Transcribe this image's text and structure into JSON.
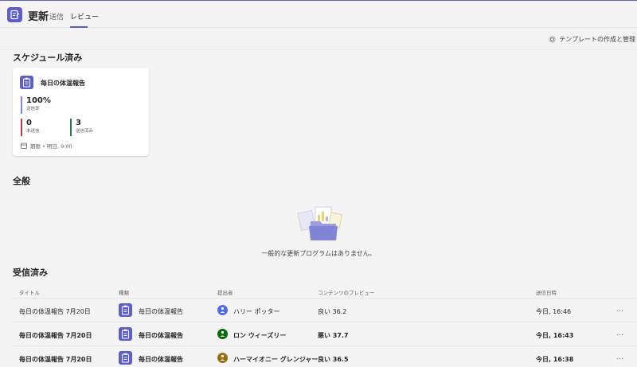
{
  "header": {
    "title": "更新",
    "tabs": [
      {
        "label": "送信"
      },
      {
        "label": "レビュー"
      }
    ]
  },
  "toolbar": {
    "template_link": "テンプレートの作成と管理"
  },
  "scheduled": {
    "title": "スケジュール済み",
    "card": {
      "title": "毎日の体温報告",
      "rate_value": "100%",
      "rate_label": "送信率",
      "unsent_value": "0",
      "unsent_label": "未送信",
      "sent_value": "3",
      "sent_label": "送信済み",
      "due": "期限 • 明日, 9:00"
    }
  },
  "general": {
    "title": "全般",
    "empty_text": "一般的な更新プログラムはありません。"
  },
  "received": {
    "title": "受信済み",
    "columns": [
      "タイトル",
      "種類",
      "提出者",
      "コンテンツのプレビュー",
      "送信日時"
    ],
    "rows": [
      {
        "title": "毎日の体温報告 7月20日",
        "type": "毎日の体温報告",
        "submitter": "ハリー ポッター",
        "preview": "良い 36.2",
        "sent": "今日, 16:46",
        "more": "...",
        "avatar_color": "#4f6bed"
      },
      {
        "title": "毎日の体温報告 7月20日",
        "type": "毎日の体温報告",
        "submitter": "ロン ウィーズリー",
        "preview": "悪い 37.7",
        "sent": "今日, 16:43",
        "more": "...",
        "avatar_color": "#0b6a0b"
      },
      {
        "title": "毎日の体温報告 7月20日",
        "type": "毎日の体温報告",
        "submitter": "ハーマイオニー グレンジャー",
        "preview": "良い 36.5",
        "sent": "今日, 16:38",
        "more": "...",
        "avatar_color": "#986f0b"
      }
    ]
  },
  "colors": {
    "brand": "#5b5fc7",
    "rate_bar": "#7f85f5",
    "unsent_bar": "#c4314b",
    "sent_bar": "#237b4b"
  },
  "icons": {
    "app": "clipboard-edit-icon",
    "template": "gear-icon",
    "due": "calendar-icon",
    "type": "clipboard-icon",
    "avatar": "person-icon"
  }
}
